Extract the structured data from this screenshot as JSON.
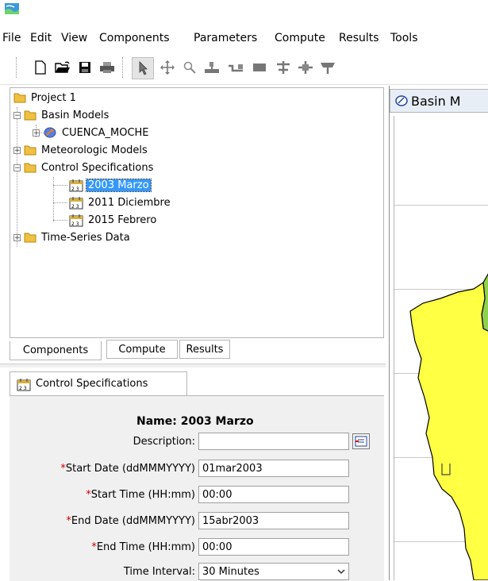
{
  "menu": [
    "File",
    "Edit",
    "View",
    "Components",
    "Parameters",
    "Compute",
    "Results",
    "Tools"
  ],
  "toolbar_icons": [
    "new-file-icon",
    "open-folder-icon",
    "save-icon",
    "print-icon",
    "pointer-icon",
    "pan-icon",
    "zoom-icon",
    "add-subbasin-icon",
    "add-reach-icon",
    "add-reservoir-icon",
    "add-junction-icon",
    "add-diversion-icon",
    "add-source-icon"
  ],
  "tree": {
    "project": "Project 1",
    "basin_models": "Basin Models",
    "basin_cuenca": "CUENCA_MOCHE",
    "meteorologic_models": "Meteorologic Models",
    "control_specifications": "Control Specifications",
    "control_2003": "2003 Marzo",
    "control_2011": "2011 Diciembre",
    "control_2015": "2015 Febrero",
    "time_series": "Time-Series Data"
  },
  "tabs": {
    "components": "Components",
    "compute": "Compute",
    "results": "Results"
  },
  "editor": {
    "tab_label": "Control Specifications",
    "name_line": "Name: 2003 Marzo",
    "description_label": "Description:",
    "description_value": "",
    "start_date_label": "Start Date (ddMMMYYYY)",
    "start_date_value": "01mar2003",
    "start_time_label": "Start Time (HH:mm)",
    "start_time_value": "00:00",
    "end_date_label": "End Date (ddMMMYYYY)",
    "end_date_value": "15abr2003",
    "end_time_label": "End Time (HH:mm)",
    "end_time_value": "00:00",
    "time_interval_label": "Time Interval:",
    "time_interval_value": "30 Minutes",
    "required_marker": "*"
  },
  "basin_panel": {
    "title": "Basin M"
  },
  "colors": {
    "selection": "#3399ff",
    "folder": "#f0c040",
    "map_basin": "#ffff44",
    "map_green": "#8fd14f",
    "required": "#d00000"
  }
}
